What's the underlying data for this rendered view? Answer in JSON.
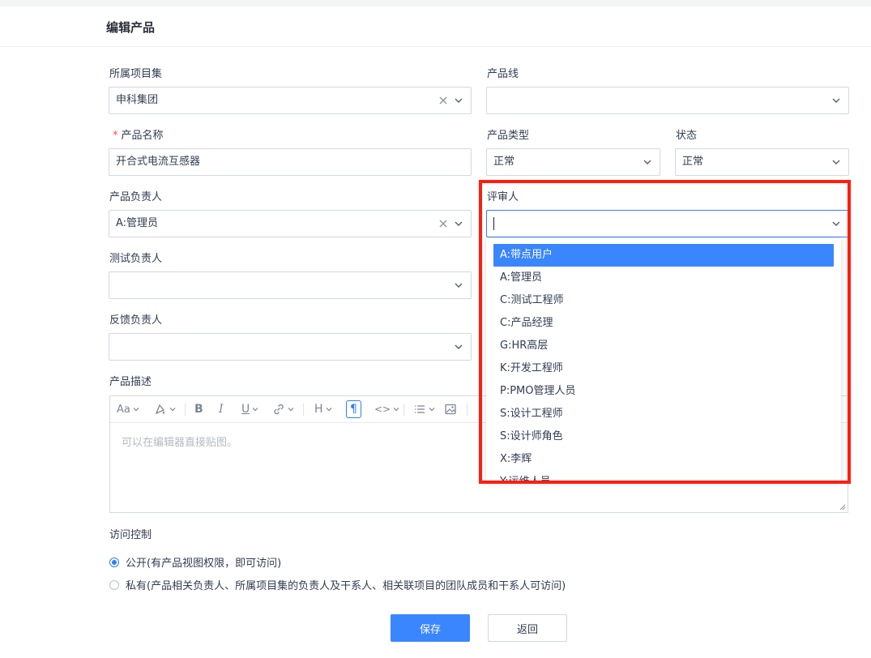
{
  "page": {
    "title": "编辑产品"
  },
  "form": {
    "project_set": {
      "label": "所属项目集",
      "value": "申科集团"
    },
    "product_line": {
      "label": "产品线",
      "value": ""
    },
    "product_name": {
      "label": "产品名称",
      "required_mark": "*",
      "value": "开合式电流互感器"
    },
    "product_type": {
      "label": "产品类型",
      "value": "正常"
    },
    "status": {
      "label": "状态",
      "value": "正常"
    },
    "product_owner": {
      "label": "产品负责人",
      "value": "A:管理员"
    },
    "reviewer": {
      "label": "评审人",
      "value": ""
    },
    "test_owner": {
      "label": "测试负责人",
      "value": ""
    },
    "feedback_owner": {
      "label": "反馈负责人",
      "value": ""
    },
    "description": {
      "label": "产品描述",
      "placeholder": "可以在编辑器直接贴图。"
    },
    "access": {
      "label": "访问控制",
      "options": [
        {
          "label": "公开(有产品视图权限，即可访问)",
          "checked": true
        },
        {
          "label": "私有(产品相关负责人、所属项目集的负责人及干系人、相关联项目的团队成员和干系人可访问)",
          "checked": false
        }
      ]
    }
  },
  "reviewer_dropdown": {
    "options": [
      {
        "label": "A:带点用户",
        "selected": true
      },
      {
        "label": "A:管理员"
      },
      {
        "label": "C:测试工程师"
      },
      {
        "label": "C:产品经理"
      },
      {
        "label": "G:HR高层"
      },
      {
        "label": "K:开发工程师"
      },
      {
        "label": "P:PMO管理人员"
      },
      {
        "label": "S:设计工程师"
      },
      {
        "label": "S:设计师角色"
      },
      {
        "label": "X:李辉"
      },
      {
        "label": "Y:运维人员"
      }
    ]
  },
  "toolbar": {
    "font_size_glyph": "Aa",
    "bold_glyph": "B",
    "italic_glyph": "I",
    "underline_glyph": "U",
    "heading_glyph": "H",
    "paragraph_glyph": "¶",
    "code_glyph": "<>"
  },
  "actions": {
    "save_label": "保存",
    "back_label": "返回"
  },
  "colors": {
    "primary": "#3a86ff",
    "highlight_box": "#ff1d0e",
    "required": "#ff4d4f"
  }
}
